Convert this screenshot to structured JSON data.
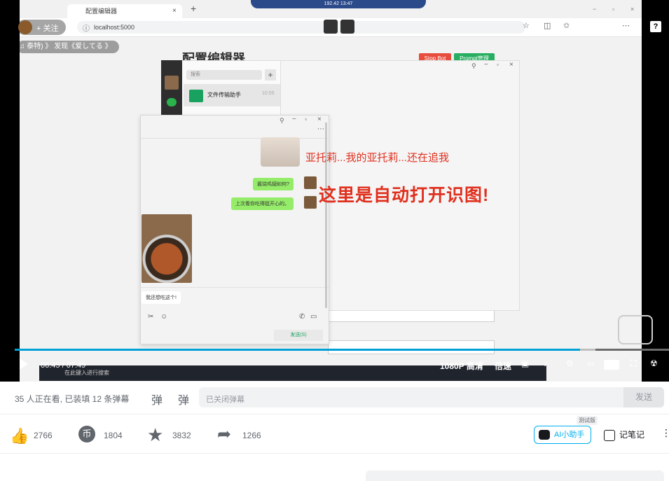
{
  "browser": {
    "tab_title": "配置编辑器",
    "url": "localhost:5000",
    "video_overlay_time": "192.42 13:47"
  },
  "uploader": {
    "follow_label": "+ 关注",
    "ticker": "♫ 泰特) 》 发现《爱してる 》"
  },
  "config_page": {
    "title": "配置编辑器",
    "stop_bot_label": "Stop Bot",
    "prompt_label": "Prompt管理"
  },
  "wechat": {
    "search_placeholder": "搜索",
    "contact_name": "文件传输助手",
    "contact_time": "10:55",
    "messages": [
      {
        "side": "right",
        "text": "酱烧鸡翅如何?"
      },
      {
        "side": "right",
        "text": "上次看你吃得挺开心的。"
      },
      {
        "side": "left",
        "text": "我还想吃这个!"
      }
    ],
    "send_label": "发送(S)"
  },
  "overlay_text": {
    "line1": "亚托莉...我的亚托莉...还在追我",
    "line2": "这里是自动打开识图!"
  },
  "player": {
    "time_current": "06:45",
    "time_total": "07:49",
    "progress_fraction": 0.864,
    "buffer_fraction": 0.888,
    "quality_label": "1080P 高清",
    "speed_label": "倍速",
    "accent_color": "#00a1d6",
    "taskbar_search": "在此键入进行搜索"
  },
  "danmaku": {
    "info": "35 人正在看, 已装填 12 条弹幕",
    "input_placeholder": "已关闭弹幕",
    "send_label": "发送"
  },
  "actions": {
    "like_count": "2766",
    "coin_count": "1804",
    "fav_count": "3832",
    "share_count": "1266",
    "ai_label": "AI小助手",
    "ai_badge": "测试版",
    "notes_label": "记笔记"
  }
}
